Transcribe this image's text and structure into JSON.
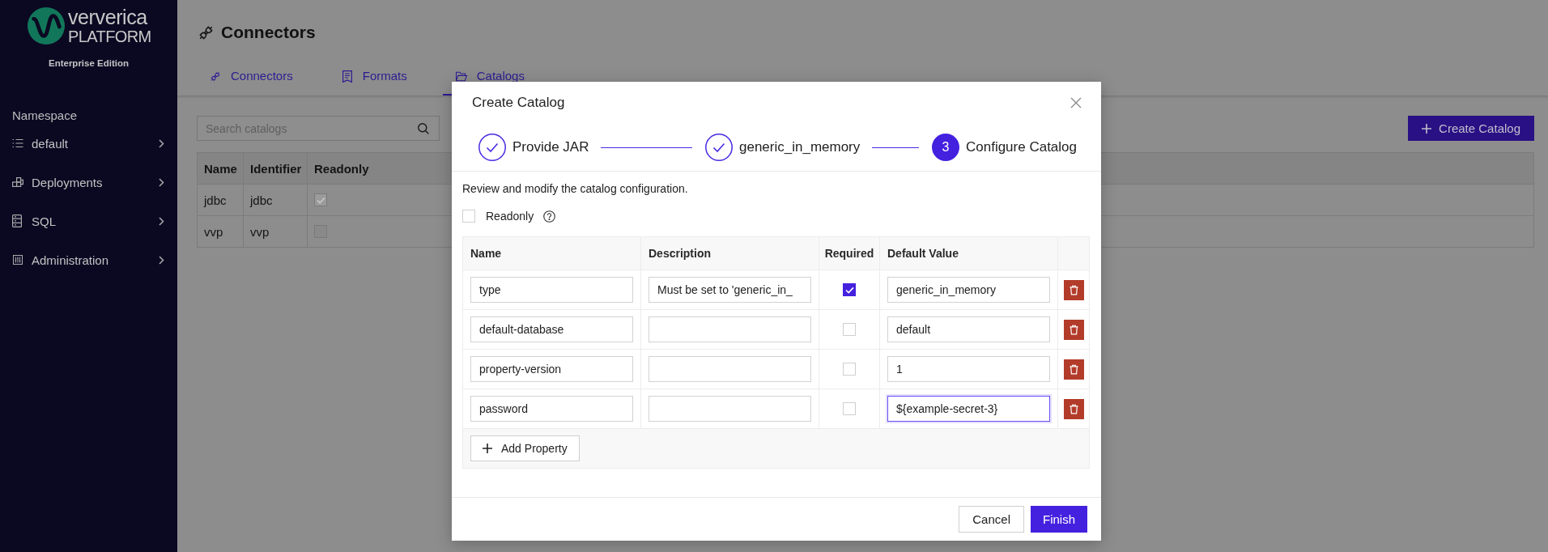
{
  "sidebar": {
    "logo": {
      "wordmark": "ververica",
      "product": "PLATFORM",
      "edition": "Enterprise Edition"
    },
    "section_label": "Namespace",
    "items": [
      {
        "label": "default"
      },
      {
        "label": "Deployments"
      },
      {
        "label": "SQL"
      },
      {
        "label": "Administration"
      }
    ]
  },
  "page": {
    "title": "Connectors",
    "tabs": [
      {
        "label": "Connectors",
        "selected": false
      },
      {
        "label": "Formats",
        "selected": false
      },
      {
        "label": "Catalogs",
        "selected": true
      }
    ],
    "search": {
      "placeholder": "Search catalogs"
    },
    "create_button": "Create Catalog",
    "table": {
      "columns": [
        "Name",
        "Identifier",
        "Readonly"
      ],
      "rows": [
        {
          "name": "jdbc",
          "identifier": "jdbc",
          "readonly": true
        },
        {
          "name": "vvp",
          "identifier": "vvp",
          "readonly": false
        }
      ]
    }
  },
  "dialog": {
    "title": "Create Catalog",
    "steps": [
      {
        "label": "Provide JAR",
        "completed": true
      },
      {
        "label": "generic_in_memory",
        "completed": true
      },
      {
        "number": "3",
        "label": "Configure Catalog",
        "completed": false
      }
    ],
    "intro": "Review and modify the catalog configuration.",
    "readonly": {
      "label": "Readonly",
      "checked": false
    },
    "properties": {
      "columns": [
        "Name",
        "Description",
        "Required",
        "Default Value"
      ],
      "rows": [
        {
          "name": "type",
          "description": "Must be set to 'generic_in_",
          "required": true,
          "default_value": {
            "value": "generic_in_memory",
            "focused": false
          }
        },
        {
          "name": "default-database",
          "required": false,
          "default_value": {
            "value": "default",
            "focused": false
          }
        },
        {
          "name": "property-version",
          "required": false,
          "default_value": {
            "value": "1",
            "focused": false
          }
        },
        {
          "name": "password",
          "required": false,
          "default_value": {
            "value": "${example-secret-3}",
            "focused": true
          }
        }
      ],
      "add_button": "Add Property"
    },
    "buttons": [
      {
        "label": "Cancel",
        "kind": "secondary"
      },
      {
        "label": "Finish",
        "kind": "primary"
      }
    ]
  }
}
